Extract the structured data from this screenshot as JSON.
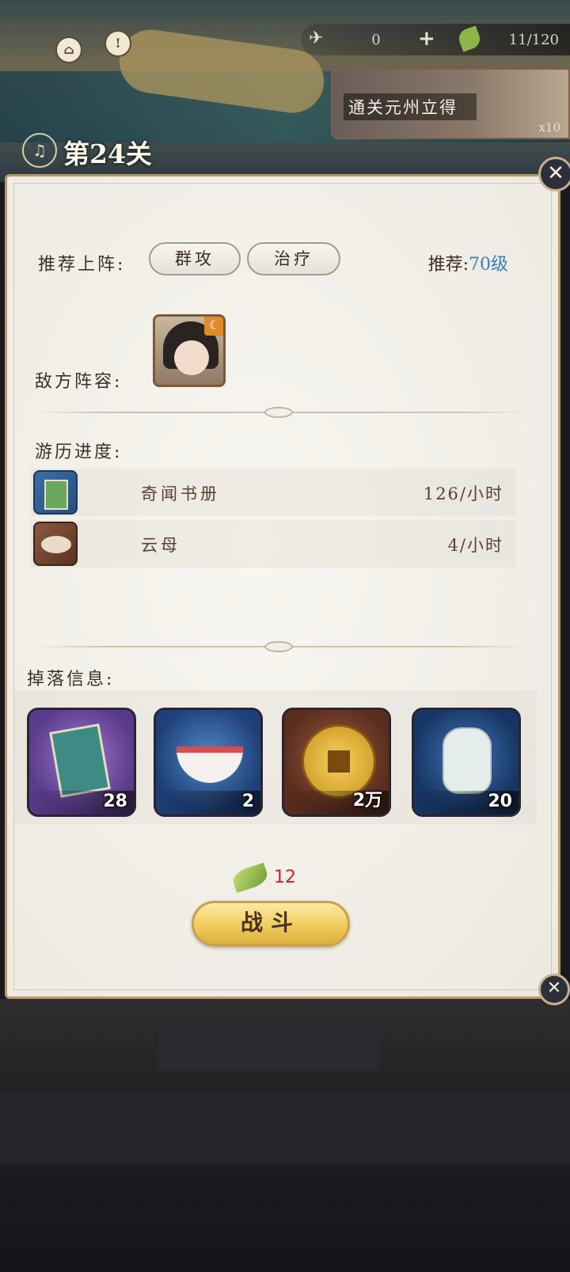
{
  "hud": {
    "crane_count": "0",
    "plus": "+",
    "stamina": "11/120"
  },
  "reward_banner": {
    "text": "通关元州立得",
    "multiplier": "x10"
  },
  "stage": {
    "title": "第24关"
  },
  "panel": {
    "recommend_label": "推荐上阵:",
    "tags": [
      "群攻",
      "治疗"
    ],
    "recommend_level_label": "推荐:",
    "recommend_level_value": "70级",
    "enemy_label": "敌方阵容:",
    "progress_label": "游历进度:",
    "progress_items": [
      {
        "name": "奇闻书册",
        "rate": "126/小时",
        "icon": "book-icon"
      },
      {
        "name": "云母",
        "rate": "4/小时",
        "icon": "mica-icon"
      }
    ],
    "drops_label": "掉落信息:",
    "drops": [
      {
        "qty": "28",
        "icon": "medicine-book-icon",
        "color": "#6a4a9a"
      },
      {
        "qty": "2",
        "icon": "bowl-icon",
        "color": "#2a5a9a"
      },
      {
        "qty": "2万",
        "icon": "coin-icon",
        "color": "#7a3e26"
      },
      {
        "qty": "20",
        "icon": "wine-jar-icon",
        "color": "#24477e"
      }
    ],
    "stamina_cost": "12",
    "fight_label": "战斗"
  }
}
